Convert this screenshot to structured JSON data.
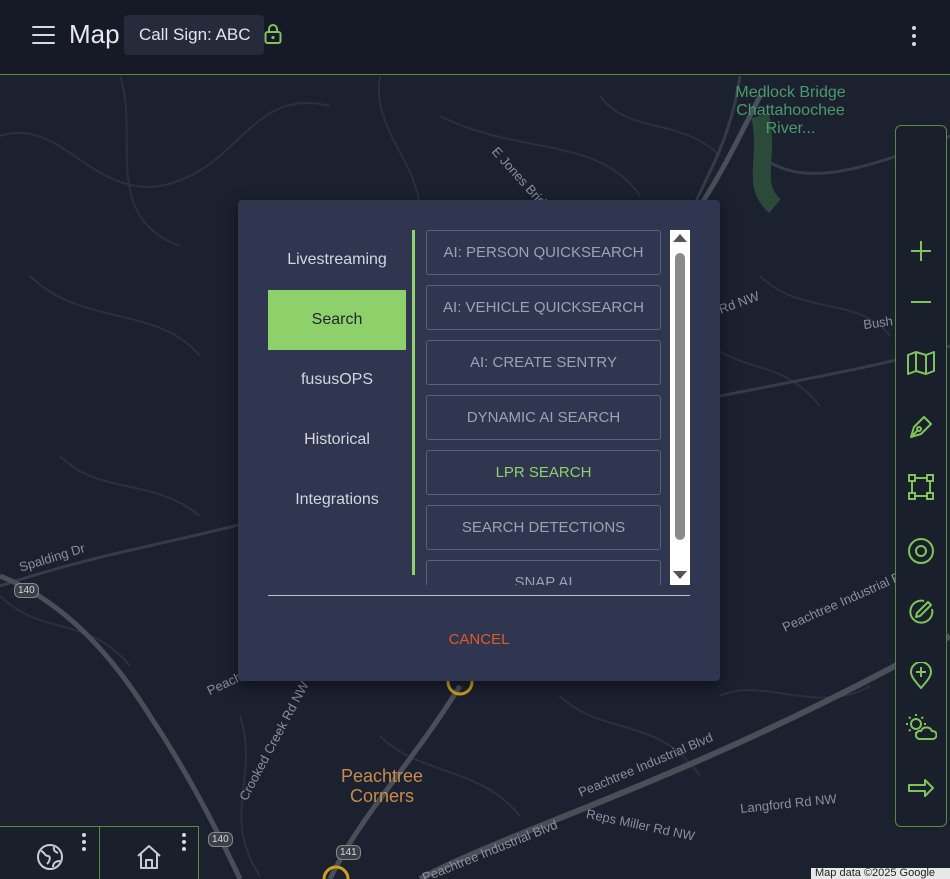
{
  "header": {
    "title": "Map",
    "call_sign": "Call Sign: ABC",
    "icons": {
      "menu": "hamburger-icon",
      "lock": "lock-icon",
      "more": "kebab-icon"
    }
  },
  "map": {
    "labels": {
      "medlock": "Medlock Bridge Chattahoochee River...",
      "ejones": "E Jones Bridge Rd",
      "bush": "Bush Rd NW",
      "rdnw": "Rd NW",
      "spalding": "Spalding Dr",
      "crooked": "Crooked Creek Rd NW",
      "peachtree_corners": "Peachtree Corners",
      "pib_right": "Peachtree Industrial Blvd",
      "pib_middle": "Peachtree Industrial Blvd",
      "pib_bottom": "Peachtree Industrial Blvd",
      "reps": "Reps Miller Rd NW",
      "langford": "Langford Rd NW",
      "peach_left": "Peach"
    },
    "shields": {
      "s140a": "140",
      "s140b": "140",
      "s141": "141"
    },
    "attribution": "Map data ©2025 Google"
  },
  "colors": {
    "accent": "#8ed16a",
    "cancel": "#e05a2b",
    "modal_bg": "#303550",
    "header_bg": "#161a26"
  },
  "toolbar": [
    "zoom-in-icon",
    "zoom-out-icon",
    "map-layers-icon",
    "draw-pen-icon",
    "polygon-icon",
    "target-circle-icon",
    "edit-icon",
    "add-location-icon",
    "weather-icon",
    "arrow-right-icon"
  ],
  "modal": {
    "nav": [
      "Livestreaming",
      "Search",
      "fususOPS",
      "Historical",
      "Integrations"
    ],
    "active_nav": "Search",
    "options": [
      "AI: PERSON QUICKSEARCH",
      "AI: VEHICLE QUICKSEARCH",
      "AI: CREATE SENTRY",
      "DYNAMIC AI SEARCH",
      "LPR SEARCH",
      "SEARCH DETECTIONS",
      "SNAP AI"
    ],
    "cancel_label": "CANCEL"
  },
  "bottom": [
    "globe-icon",
    "home-icon"
  ]
}
